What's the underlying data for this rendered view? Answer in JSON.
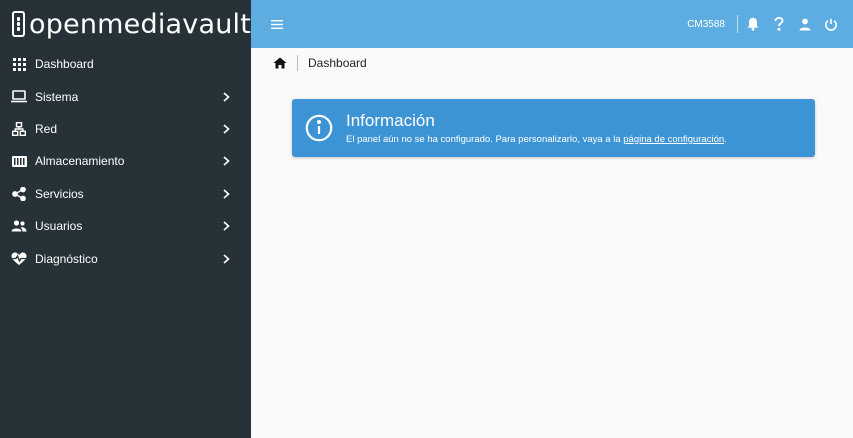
{
  "brand": {
    "name": "openmediavault"
  },
  "sidebar": {
    "items": [
      {
        "label": "Dashboard",
        "icon": "dashboard-grid-icon",
        "has_children": false
      },
      {
        "label": "Sistema",
        "icon": "laptop-icon",
        "has_children": true
      },
      {
        "label": "Red",
        "icon": "network-icon",
        "has_children": true
      },
      {
        "label": "Almacenamiento",
        "icon": "storage-icon",
        "has_children": true
      },
      {
        "label": "Servicios",
        "icon": "share-icon",
        "has_children": true
      },
      {
        "label": "Usuarios",
        "icon": "users-icon",
        "has_children": true
      },
      {
        "label": "Diagnóstico",
        "icon": "heart-pulse-icon",
        "has_children": true
      }
    ]
  },
  "topbar": {
    "hostname": "CM3588",
    "icons": [
      "menu-icon",
      "bell-icon",
      "help-icon",
      "user-icon",
      "power-icon"
    ]
  },
  "breadcrumb": {
    "current": "Dashboard"
  },
  "info": {
    "title": "Información",
    "text": "El panel aún no se ha configurado. Para personalizarlo, vaya a la ",
    "link": "página de configuración",
    "text_after": "."
  },
  "colors": {
    "sidebar_bg": "#263238",
    "topbar_bg": "#5dade2",
    "info_bg": "#3d94d4",
    "page_bg": "#fafafa"
  }
}
